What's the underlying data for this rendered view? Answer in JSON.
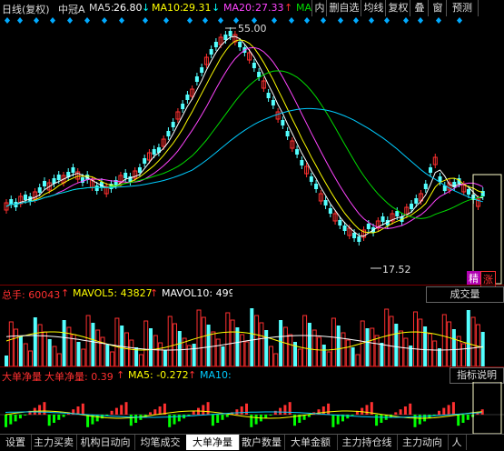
{
  "header": {
    "period": "日线(复权)",
    "stock": "中冠A",
    "ma5_label": "MA5:",
    "ma5_value": "26.80",
    "ma5_arrow": "↓",
    "ma10_label": "MA10:",
    "ma10_value": "29.31",
    "ma10_arrow": "↓",
    "ma20_label": "MA20:",
    "ma20_value": "27.33",
    "ma20_arrow": "↑",
    "ma_more": "MA"
  },
  "toolbar": [
    "内",
    "删自选",
    "均线",
    "复权",
    "叠",
    "窗",
    "预测"
  ],
  "colors": {
    "ma5": "#ffffff",
    "ma10": "#ffff00",
    "ma20": "#ff44ff",
    "ma60": "#00dd00",
    "ma120": "#00ccff",
    "up": "#ff3030",
    "down": "#54ffff",
    "label_red": "#ff3030",
    "label_ma5": "#ffff00"
  },
  "price_chart": {
    "high_label": "55.00",
    "low_label": "17.52",
    "badge_1": "精",
    "badge_2": "涨"
  },
  "volume_panel": {
    "title": "总手: 60043",
    "title_arrow": "↑",
    "mavol5": "MAVOL5: 43827",
    "mavol5_arrow": "↑",
    "mavol10": "MAVOL10: 4992",
    "indicator_button": "成交量"
  },
  "net_panel": {
    "title": "大单净量",
    "label": "大单净量: 0.39",
    "label_arrow": "↑",
    "ma5": "MA5: -0.272",
    "ma5_arrow": "↑",
    "ma10": "MA10: -0.163",
    "indicator_button": "指标说明"
  },
  "tabs": [
    "设置",
    "主力买卖",
    "机构日动向",
    "均笔成交",
    "大单净量",
    "散户数量",
    "大单金额",
    "主力持仓线",
    "主力动向",
    "人"
  ],
  "active_tab": "大单净量"
}
